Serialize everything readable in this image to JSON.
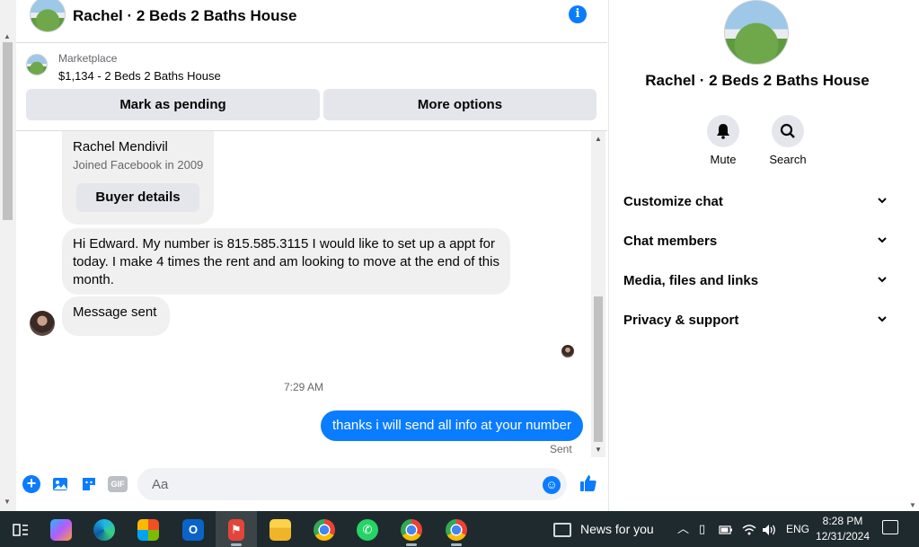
{
  "chat": {
    "title": "Rachel · 2 Beds 2 Baths House",
    "marketplace": {
      "label": "Marketplace",
      "listing": "$1,134 - 2 Beds 2 Baths House",
      "pending_button": "Mark as pending",
      "more_button": "More options"
    },
    "card": {
      "name": "Rachel Mendivil",
      "subtitle": "Joined Facebook in 2009",
      "buyer_button": "Buyer details"
    },
    "messages": {
      "incoming_1": "Hi Edward. My number is 815.585.3115 I would like to set up a appt for today. I make 4 times the rent and am looking to move at the end of this month.",
      "incoming_2": "Message sent",
      "timestamp": "7:29 AM",
      "outgoing": "thanks i will send all info at your number",
      "status": "Sent"
    },
    "composer": {
      "placeholder": "Aa",
      "icons": [
        "plus-icon",
        "image-icon",
        "sticker-icon",
        "gif-icon",
        "emoji-icon",
        "like-icon"
      ],
      "gif_label": "GIF"
    },
    "accent_color": "#0a7cff"
  },
  "info_panel": {
    "title": "Rachel · 2 Beds 2 Baths House",
    "actions": [
      {
        "label": "Mute",
        "icon": "bell-icon"
      },
      {
        "label": "Search",
        "icon": "search-icon"
      }
    ],
    "sections": [
      {
        "label": "Customize chat"
      },
      {
        "label": "Chat members"
      },
      {
        "label": "Media, files and links"
      },
      {
        "label": "Privacy & support"
      }
    ]
  },
  "taskbar": {
    "apps": [
      "task-view",
      "copilot",
      "edge",
      "store",
      "outlook",
      "app-active",
      "file-explorer",
      "chrome",
      "whatsapp",
      "chrome-profile-c",
      "chrome-profile-2"
    ],
    "news": "News for you",
    "language": "ENG",
    "time": "8:28 PM",
    "date": "12/31/2024"
  }
}
